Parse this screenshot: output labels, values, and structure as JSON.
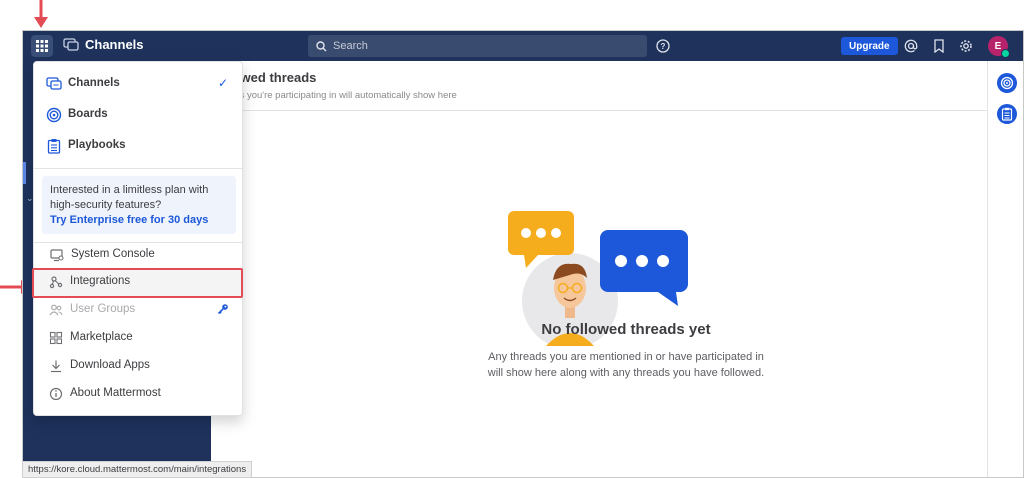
{
  "header": {
    "product_name": "Channels",
    "search_placeholder": "Search",
    "upgrade_label": "Upgrade",
    "avatar_initial": "E"
  },
  "center": {
    "title": "lowed threads",
    "subtitle": "ads you're participating in will automatically show here",
    "empty_title": "No followed threads yet",
    "empty_desc_line1": "Any threads you are mentioned in or have participated in",
    "empty_desc_line2": "will show here along with any threads you have followed."
  },
  "menu": {
    "products": [
      {
        "label": "Channels",
        "icon": "channels-icon",
        "checked": true
      },
      {
        "label": "Boards",
        "icon": "boards-icon",
        "checked": false
      },
      {
        "label": "Playbooks",
        "icon": "playbooks-icon",
        "checked": false
      }
    ],
    "promo_text": "Interested in a limitless plan with high-security features?",
    "promo_link": "Try Enterprise free for 30 days",
    "items": [
      {
        "label": "System Console",
        "icon": "system-console-icon"
      },
      {
        "label": "Integrations",
        "icon": "integrations-icon"
      },
      {
        "label": "User Groups",
        "icon": "user-groups-icon"
      },
      {
        "label": "Marketplace",
        "icon": "marketplace-icon"
      },
      {
        "label": "Download Apps",
        "icon": "download-icon"
      },
      {
        "label": "About Mattermost",
        "icon": "info-icon"
      }
    ],
    "check_mark": "✓"
  },
  "statusbar": {
    "url": "https://kore.cloud.mattermost.com/main/integrations"
  },
  "colors": {
    "topbar": "#1e325c",
    "accent": "#1c58d9",
    "highlight": "#e34b55"
  }
}
